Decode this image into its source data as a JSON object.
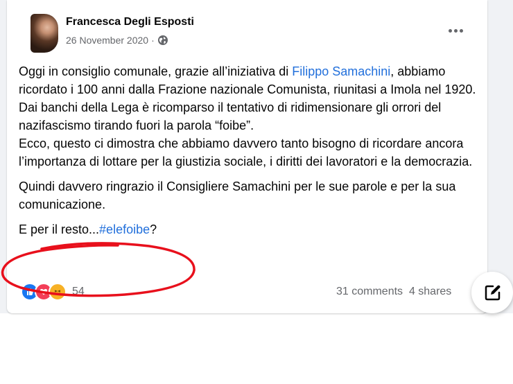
{
  "post": {
    "author": "Francesca Degli Esposti",
    "date": "26 November 2020",
    "separator": "·",
    "paragraphs": {
      "p1_pre": "Oggi in consiglio comunale, grazie all’iniziativa di ",
      "p1_link": "Filippo Samachini",
      "p1_post": ", abbiamo ricordato i 100 anni dalla Frazione nazionale Comunista, riunitasi a Imola nel 1920.",
      "p2": "Dai banchi della Lega è ricomparso il tentativo di ridimensionare gli orrori del nazifascismo tirando fuori la parola “foibe”.",
      "p3": "Ecco, questo ci dimostra che abbiamo davvero tanto bisogno di ricordare ancora l’importanza di lottare per la giustizia sociale, i diritti dei lavoratori e la democrazia.",
      "p4": "Quindi davvero ringrazio il Consigliere Samachini per le sue parole e per la sua comunicazione.",
      "p5_pre": "E per il resto...",
      "p5_tag": "#elefoibe",
      "p5_post": "?"
    }
  },
  "reactions": {
    "icons": [
      "like-icon",
      "love-icon",
      "haha-icon"
    ],
    "count": "54"
  },
  "stats": {
    "comments": "31 comments",
    "shares": "4 shares"
  },
  "colors": {
    "link": "#216fdb",
    "annotation": "#e8101c",
    "like": "#1877f2",
    "love": "#f33e58",
    "haha": "#f7b125"
  }
}
